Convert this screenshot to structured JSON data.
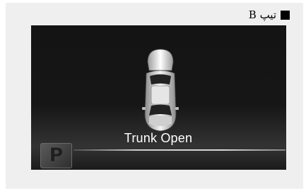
{
  "label": {
    "type_text": "تیپ B",
    "square_icon": "black-square-icon"
  },
  "cluster_display": {
    "message": "Trunk Open",
    "gear_indicator": "P",
    "car_icon": "car-top-view-trunk-open-icon"
  },
  "colors": {
    "display_background": "#1a1a1a",
    "panel_background": "#efefef",
    "text_color": "#ffffff"
  }
}
